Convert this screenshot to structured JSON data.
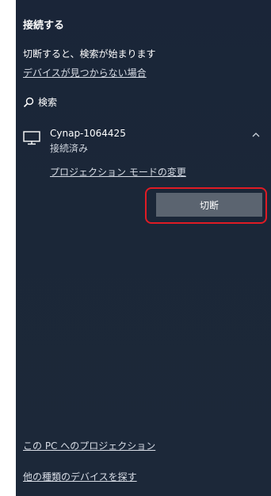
{
  "panel": {
    "title": "接続する",
    "status_text": "切断すると、検索が始まります",
    "help_link": "デバイスが見つからない場合",
    "search_label": "検索"
  },
  "device": {
    "icon": "monitor-icon",
    "name": "Cynap-1064425",
    "status": "接続済み",
    "expanded_icon": "chevron-up-icon",
    "projection_mode_link": "プロジェクション モードの変更",
    "disconnect_label": "切断"
  },
  "footer": {
    "project_to_pc_link": "この PC へのプロジェクション",
    "find_other_devices_link": "他の種類のデバイスを探す"
  },
  "colors": {
    "panel_background": "#1b2738",
    "button_background": "#5b6470",
    "highlight": "#e01b24"
  }
}
